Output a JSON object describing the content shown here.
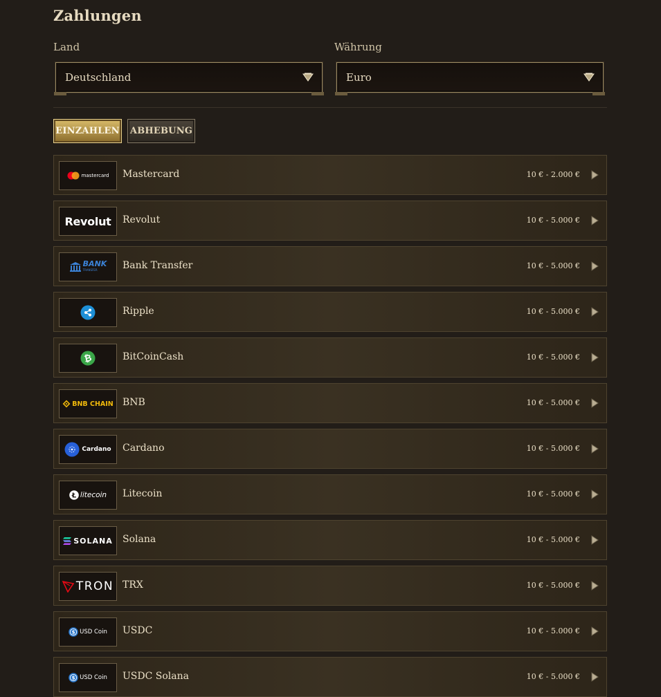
{
  "page": {
    "title": "Zahlungen"
  },
  "filters": {
    "country": {
      "label": "Land",
      "value": "Deutschland"
    },
    "currency": {
      "label": "Währung",
      "value": "Euro"
    }
  },
  "tabs": [
    {
      "label": "EINZAHLEN",
      "active": true
    },
    {
      "label": "ABHEBUNG",
      "active": false
    }
  ],
  "colors": {
    "accent": "#d9bc6a",
    "text": "#ece1c8",
    "background": "#221d18"
  },
  "methods": [
    {
      "name": "Mastercard",
      "limit": "10 € - 2.000 €",
      "logo": "mastercard-logo",
      "logo_text": "mastercard"
    },
    {
      "name": "Revolut",
      "limit": "10 € - 5.000 €",
      "logo": "revolut-logo",
      "logo_text": "Revolut"
    },
    {
      "name": "Bank Transfer",
      "limit": "10 € - 5.000 €",
      "logo": "bank-transfer-logo",
      "logo_text": "BANK",
      "logo_subtext": "TRANSFER"
    },
    {
      "name": "Ripple",
      "limit": "10 € - 5.000 €",
      "logo": "ripple-logo"
    },
    {
      "name": "BitCoinCash",
      "limit": "10 € - 5.000 €",
      "logo": "bitcoincash-logo"
    },
    {
      "name": "BNB",
      "limit": "10 € - 5.000 €",
      "logo": "bnb-chain-logo",
      "logo_text": "BNB CHAIN"
    },
    {
      "name": "Cardano",
      "limit": "10 € - 5.000 €",
      "logo": "cardano-logo",
      "logo_text": "Cardano"
    },
    {
      "name": "Litecoin",
      "limit": "10 € - 5.000 €",
      "logo": "litecoin-logo",
      "logo_text": "litecoin"
    },
    {
      "name": "Solana",
      "limit": "10 € - 5.000 €",
      "logo": "solana-logo",
      "logo_text": "SOLANA"
    },
    {
      "name": "TRX",
      "limit": "10 € - 5.000 €",
      "logo": "tron-logo",
      "logo_text": "TRON"
    },
    {
      "name": "USDC",
      "limit": "10 € - 5.000 €",
      "logo": "usd-coin-logo",
      "logo_text": "USD Coin"
    },
    {
      "name": "USDC Solana",
      "limit": "10 € - 5.000 €",
      "logo": "usd-coin-logo",
      "logo_text": "USD Coin"
    }
  ]
}
